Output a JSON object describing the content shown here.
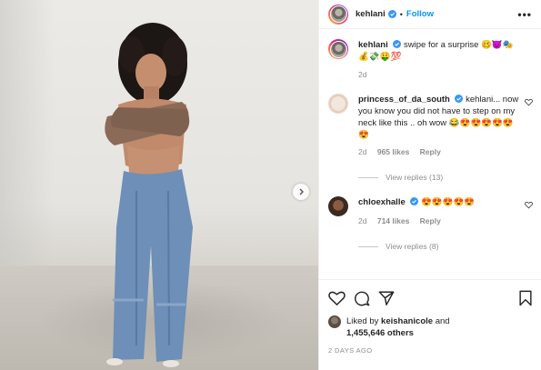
{
  "post": {
    "username": "kehlani",
    "follow_label": "Follow",
    "more_label": "•••",
    "dot": "•"
  },
  "caption": {
    "username": "kehlani",
    "text": "swipe for a surprise 🥴😈🎭 💰💸🤑💯",
    "time": "2d"
  },
  "comments": [
    {
      "username": "princess_of_da_south",
      "text": "kehlani... now you know you did not have to step on my neck like this .. oh wow 😂😍😍😍😍😍😍",
      "time": "2d",
      "likes": "965 likes",
      "reply_label": "Reply",
      "view_replies": "View replies (13)"
    },
    {
      "username": "chloexhalle",
      "text": "😍😍😍😍😍",
      "time": "2d",
      "likes": "714 likes",
      "reply_label": "Reply",
      "view_replies": "View replies (8)"
    }
  ],
  "likes": {
    "prefix": "Liked by",
    "user": "keishanicole",
    "and": "and",
    "count": "1,455,646 others"
  },
  "date": "2 DAYS AGO",
  "colors": {
    "accent": "#0095f6",
    "verified": "#3897f0",
    "muted": "#8e8e8e"
  }
}
